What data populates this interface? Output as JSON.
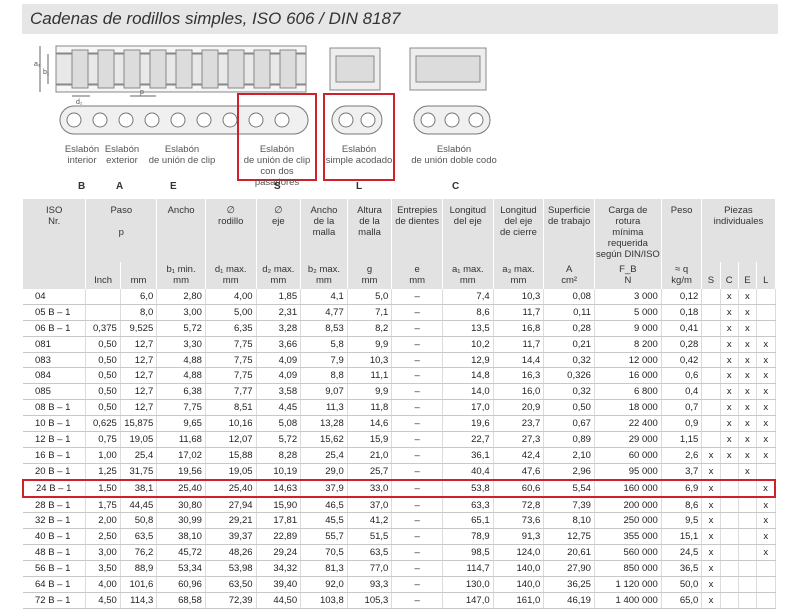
{
  "title": "Cadenas de rodillos simples, ISO 606 / DIN 8187",
  "diagram": {
    "captions": [
      "Eslabón\ninterior",
      "Eslabón\nexterior",
      "Eslabón\nde unión de clip",
      "Eslabón\nde unión de clip\ncon dos pasadores",
      "Eslabón\nsimple acodado",
      "Eslabón\nde unión doble codo"
    ],
    "letters": [
      "B",
      "A",
      "E",
      "S",
      "L",
      "C"
    ],
    "dim_labels": [
      "a₁",
      "b₁",
      "b₂",
      "d₁",
      "d₂",
      "p",
      "a₃",
      "g"
    ]
  },
  "table": {
    "headers": {
      "iso": "ISO\nNr.",
      "paso": "Paso\n\np",
      "ancho": "Ancho",
      "rodillo": "∅\nrodillo",
      "eje": "∅\neje",
      "malla": "Ancho\nde la\nmalla",
      "altura": "Altura\nde la\nmalla",
      "dientes": "Entrepies\nde dientes",
      "long_eje": "Longitud\ndel eje",
      "long_cierre": "Longitud\ndel eje\nde cierre",
      "superficie": "Superficie\nde trabajo",
      "carga": "Carga de rotura\nmínima\nrequerida\nsegún DIN/ISO",
      "peso": "Peso",
      "piezas": "Piezas\nindividuales"
    },
    "subheaders": {
      "inch": "Inch",
      "mm": "mm",
      "ancho": "b₁ min.\nmm",
      "rodillo": "d₁ max.\nmm",
      "eje": "d₂ max.\nmm",
      "malla": "b₂ max.\nmm",
      "altura": "g\nmm",
      "dientes": "e\nmm",
      "long_eje": "a₁ max.\nmm",
      "long_cierre": "a₃ max.\nmm",
      "superficie": "A\ncm²",
      "carga": "F_B\nN",
      "peso": "≈ q\nkg/m",
      "s": "S",
      "c": "C",
      "e": "E",
      "l": "L"
    },
    "rows": [
      {
        "iso": "04",
        "inch": "",
        "mm": "6,0",
        "b1": "2,80",
        "d1": "4,00",
        "d2": "1,85",
        "b2": "4,1",
        "g": "5,0",
        "e": "–",
        "a1": "7,4",
        "a3": "10,3",
        "A": "0,08",
        "FB": "3 000",
        "q": "0,12",
        "S": "",
        "C": "x",
        "E": "x",
        "L": ""
      },
      {
        "iso": "05 B – 1",
        "inch": "",
        "mm": "8,0",
        "b1": "3,00",
        "d1": "5,00",
        "d2": "2,31",
        "b2": "4,77",
        "g": "7,1",
        "e": "–",
        "a1": "8,6",
        "a3": "11,7",
        "A": "0,11",
        "FB": "5 000",
        "q": "0,18",
        "S": "",
        "C": "x",
        "E": "x",
        "L": ""
      },
      {
        "iso": "06 B – 1",
        "inch": "0,375",
        "mm": "9,525",
        "b1": "5,72",
        "d1": "6,35",
        "d2": "3,28",
        "b2": "8,53",
        "g": "8,2",
        "e": "–",
        "a1": "13,5",
        "a3": "16,8",
        "A": "0,28",
        "FB": "9 000",
        "q": "0,41",
        "S": "",
        "C": "x",
        "E": "x",
        "L": ""
      },
      {
        "iso": "081",
        "inch": "0,50",
        "mm": "12,7",
        "b1": "3,30",
        "d1": "7,75",
        "d2": "3,66",
        "b2": "5,8",
        "g": "9,9",
        "e": "–",
        "a1": "10,2",
        "a3": "11,7",
        "A": "0,21",
        "FB": "8 200",
        "q": "0,28",
        "S": "",
        "C": "x",
        "E": "x",
        "L": "x"
      },
      {
        "iso": "083",
        "inch": "0,50",
        "mm": "12,7",
        "b1": "4,88",
        "d1": "7,75",
        "d2": "4,09",
        "b2": "7,9",
        "g": "10,3",
        "e": "–",
        "a1": "12,9",
        "a3": "14,4",
        "A": "0,32",
        "FB": "12 000",
        "q": "0,42",
        "S": "",
        "C": "x",
        "E": "x",
        "L": "x"
      },
      {
        "iso": "084",
        "inch": "0,50",
        "mm": "12,7",
        "b1": "4,88",
        "d1": "7,75",
        "d2": "4,09",
        "b2": "8,8",
        "g": "11,1",
        "e": "–",
        "a1": "14,8",
        "a3": "16,3",
        "A": "0,326",
        "FB": "16 000",
        "q": "0,6",
        "S": "",
        "C": "x",
        "E": "x",
        "L": "x"
      },
      {
        "iso": "085",
        "inch": "0,50",
        "mm": "12,7",
        "b1": "6,38",
        "d1": "7,77",
        "d2": "3,58",
        "b2": "9,07",
        "g": "9,9",
        "e": "–",
        "a1": "14,0",
        "a3": "16,0",
        "A": "0,32",
        "FB": "6 800",
        "q": "0,4",
        "S": "",
        "C": "x",
        "E": "x",
        "L": "x"
      },
      {
        "iso": "08 B – 1",
        "inch": "0,50",
        "mm": "12,7",
        "b1": "7,75",
        "d1": "8,51",
        "d2": "4,45",
        "b2": "11,3",
        "g": "11,8",
        "e": "–",
        "a1": "17,0",
        "a3": "20,9",
        "A": "0,50",
        "FB": "18 000",
        "q": "0,7",
        "S": "",
        "C": "x",
        "E": "x",
        "L": "x"
      },
      {
        "iso": "10 B – 1",
        "inch": "0,625",
        "mm": "15,875",
        "b1": "9,65",
        "d1": "10,16",
        "d2": "5,08",
        "b2": "13,28",
        "g": "14,6",
        "e": "–",
        "a1": "19,6",
        "a3": "23,7",
        "A": "0,67",
        "FB": "22 400",
        "q": "0,9",
        "S": "",
        "C": "x",
        "E": "x",
        "L": "x"
      },
      {
        "iso": "12 B – 1",
        "inch": "0,75",
        "mm": "19,05",
        "b1": "11,68",
        "d1": "12,07",
        "d2": "5,72",
        "b2": "15,62",
        "g": "15,9",
        "e": "–",
        "a1": "22,7",
        "a3": "27,3",
        "A": "0,89",
        "FB": "29 000",
        "q": "1,15",
        "S": "",
        "C": "x",
        "E": "x",
        "L": "x"
      },
      {
        "iso": "16 B – 1",
        "inch": "1,00",
        "mm": "25,4",
        "b1": "17,02",
        "d1": "15,88",
        "d2": "8,28",
        "b2": "25,4",
        "g": "21,0",
        "e": "–",
        "a1": "36,1",
        "a3": "42,4",
        "A": "2,10",
        "FB": "60 000",
        "q": "2,6",
        "S": "x",
        "C": "x",
        "E": "x",
        "L": "x"
      },
      {
        "iso": "20 B – 1",
        "inch": "1,25",
        "mm": "31,75",
        "b1": "19,56",
        "d1": "19,05",
        "d2": "10,19",
        "b2": "29,0",
        "g": "25,7",
        "e": "–",
        "a1": "40,4",
        "a3": "47,6",
        "A": "2,96",
        "FB": "95 000",
        "q": "3,7",
        "S": "x",
        "C": "",
        "E": "x",
        "L": ""
      },
      {
        "iso": "24 B – 1",
        "inch": "1,50",
        "mm": "38,1",
        "b1": "25,40",
        "d1": "25,40",
        "d2": "14,63",
        "b2": "37,9",
        "g": "33,0",
        "e": "–",
        "a1": "53,8",
        "a3": "60,6",
        "A": "5,54",
        "FB": "160 000",
        "q": "6,9",
        "S": "x",
        "C": "",
        "E": "",
        "L": "x",
        "highlight": true
      },
      {
        "iso": "28 B – 1",
        "inch": "1,75",
        "mm": "44,45",
        "b1": "30,80",
        "d1": "27,94",
        "d2": "15,90",
        "b2": "46,5",
        "g": "37,0",
        "e": "–",
        "a1": "63,3",
        "a3": "72,8",
        "A": "7,39",
        "FB": "200 000",
        "q": "8,6",
        "S": "x",
        "C": "",
        "E": "",
        "L": "x"
      },
      {
        "iso": "32 B – 1",
        "inch": "2,00",
        "mm": "50,8",
        "b1": "30,99",
        "d1": "29,21",
        "d2": "17,81",
        "b2": "45,5",
        "g": "41,2",
        "e": "–",
        "a1": "65,1",
        "a3": "73,6",
        "A": "8,10",
        "FB": "250 000",
        "q": "9,5",
        "S": "x",
        "C": "",
        "E": "",
        "L": "x"
      },
      {
        "iso": "40 B – 1",
        "inch": "2,50",
        "mm": "63,5",
        "b1": "38,10",
        "d1": "39,37",
        "d2": "22,89",
        "b2": "55,7",
        "g": "51,5",
        "e": "–",
        "a1": "78,9",
        "a3": "91,3",
        "A": "12,75",
        "FB": "355 000",
        "q": "15,1",
        "S": "x",
        "C": "",
        "E": "",
        "L": "x"
      },
      {
        "iso": "48 B – 1",
        "inch": "3,00",
        "mm": "76,2",
        "b1": "45,72",
        "d1": "48,26",
        "d2": "29,24",
        "b2": "70,5",
        "g": "63,5",
        "e": "–",
        "a1": "98,5",
        "a3": "124,0",
        "A": "20,61",
        "FB": "560 000",
        "q": "24,5",
        "S": "x",
        "C": "",
        "E": "",
        "L": "x"
      },
      {
        "iso": "56 B – 1",
        "inch": "3,50",
        "mm": "88,9",
        "b1": "53,34",
        "d1": "53,98",
        "d2": "34,32",
        "b2": "81,3",
        "g": "77,0",
        "e": "–",
        "a1": "114,7",
        "a3": "140,0",
        "A": "27,90",
        "FB": "850 000",
        "q": "36,5",
        "S": "x",
        "C": "",
        "E": "",
        "L": ""
      },
      {
        "iso": "64 B – 1",
        "inch": "4,00",
        "mm": "101,6",
        "b1": "60,96",
        "d1": "63,50",
        "d2": "39,40",
        "b2": "92,0",
        "g": "93,3",
        "e": "–",
        "a1": "130,0",
        "a3": "140,0",
        "A": "36,25",
        "FB": "1 120 000",
        "q": "50,0",
        "S": "x",
        "C": "",
        "E": "",
        "L": ""
      },
      {
        "iso": "72 B – 1",
        "inch": "4,50",
        "mm": "114,3",
        "b1": "68,58",
        "d1": "72,39",
        "d2": "44,50",
        "b2": "103,8",
        "g": "105,3",
        "e": "–",
        "a1": "147,0",
        "a3": "161,0",
        "A": "46,19",
        "FB": "1 400 000",
        "q": "65,0",
        "S": "x",
        "C": "",
        "E": "",
        "L": ""
      }
    ]
  },
  "colors": {
    "highlight": "#d0202a",
    "header_bg": "#e2e2e2",
    "title_bg": "#e6e6e6"
  }
}
